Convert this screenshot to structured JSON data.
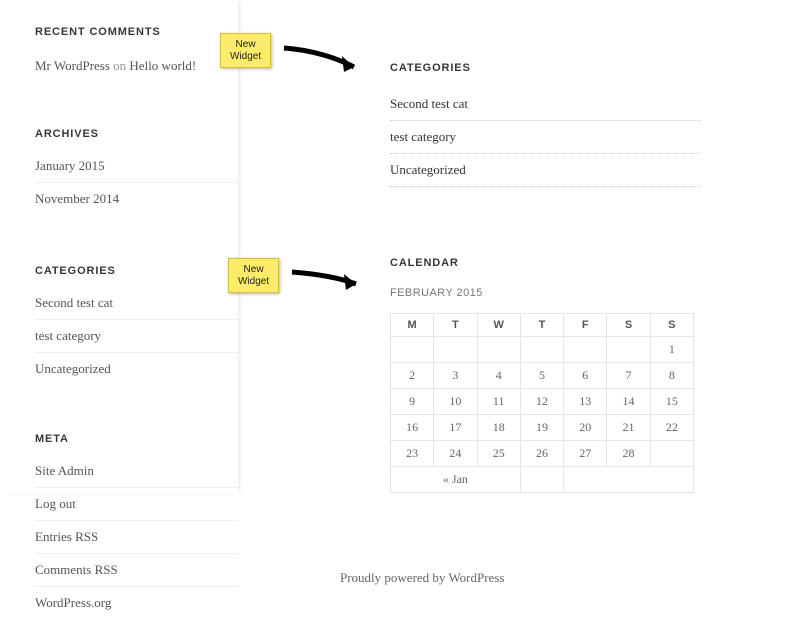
{
  "sidebar": {
    "recent_comments": {
      "title": "RECENT COMMENTS",
      "author": "Mr WordPress",
      "on_word": "on",
      "post": "Hello world!"
    },
    "archives": {
      "title": "ARCHIVES",
      "items": [
        "January 2015",
        "November 2014"
      ]
    },
    "categories": {
      "title": "CATEGORIES",
      "items": [
        "Second test cat",
        "test category",
        "Uncategorized"
      ]
    },
    "meta": {
      "title": "META",
      "items": [
        "Site Admin",
        "Log out",
        "Entries RSS",
        "Comments RSS",
        "WordPress.org"
      ]
    }
  },
  "main": {
    "categories": {
      "title": "CATEGORIES",
      "items": [
        "Second test cat",
        "test category",
        "Uncategorized"
      ]
    },
    "calendar": {
      "title": "CALENDAR",
      "caption": "FEBRUARY 2015",
      "dow": [
        "M",
        "T",
        "W",
        "T",
        "F",
        "S",
        "S"
      ],
      "weeks": [
        [
          "",
          "",
          "",
          "",
          "",
          "",
          "1"
        ],
        [
          "2",
          "3",
          "4",
          "5",
          "6",
          "7",
          "8"
        ],
        [
          "9",
          "10",
          "11",
          "12",
          "13",
          "14",
          "15"
        ],
        [
          "16",
          "17",
          "18",
          "19",
          "20",
          "21",
          "22"
        ],
        [
          "23",
          "24",
          "25",
          "26",
          "27",
          "28",
          ""
        ]
      ],
      "prev": "« Jan"
    }
  },
  "footer": {
    "credit": "Proudly powered by WordPress"
  },
  "annotations": {
    "label1": "New\nWidget",
    "label2": "New\nWidget"
  }
}
